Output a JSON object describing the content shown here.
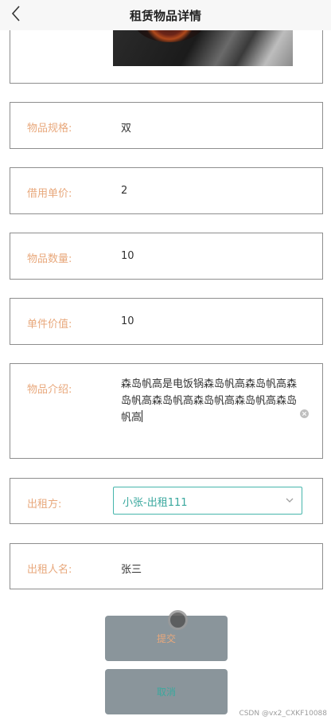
{
  "navbar": {
    "title": "租赁物品详情",
    "back_icon": "chevron-left-icon"
  },
  "fields": {
    "spec": {
      "label": "物品规格:",
      "value": "双"
    },
    "price": {
      "label": "借用单价:",
      "value": "2"
    },
    "qty": {
      "label": "物品数量:",
      "value": "10"
    },
    "worth": {
      "label": "单件价值:",
      "value": "10"
    },
    "intro": {
      "label": "物品介绍:",
      "value": "森岛帆高是电饭锅森岛帆高森岛帆高森岛帆高森岛帆高森岛帆高森岛帆高森岛帆高"
    },
    "lessor": {
      "label": "出租方:",
      "selected": "小张-出租111"
    },
    "lessor_name": {
      "label": "出租人名:",
      "value": "张三"
    }
  },
  "buttons": {
    "submit": "提交",
    "cancel": "取消"
  },
  "watermark": "CSDN @vx2_CXKF10088",
  "colors": {
    "label": "#e8a87c",
    "accent": "#46b6ac",
    "button_bg": "#8a959b",
    "border": "#8e8e8e"
  }
}
